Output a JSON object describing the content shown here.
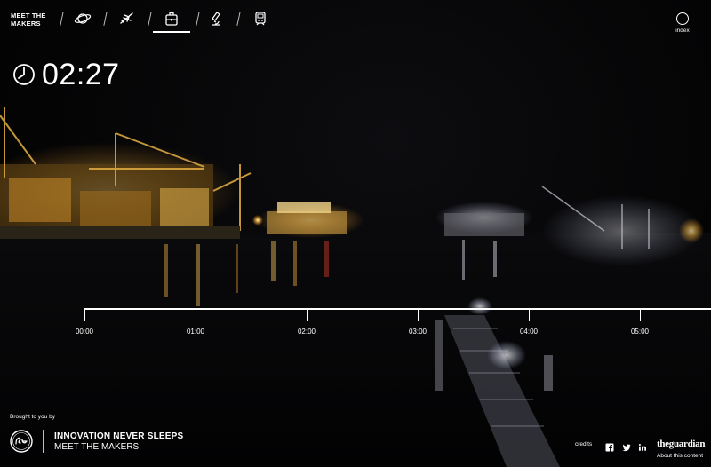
{
  "brand": {
    "line1": "MEET THE",
    "line2": "MAKERS"
  },
  "nav": {
    "items": [
      {
        "name": "planet",
        "icon": "planet-icon"
      },
      {
        "name": "aviation",
        "icon": "airplane-icon"
      },
      {
        "name": "shipping",
        "icon": "luggage-icon",
        "active": true
      },
      {
        "name": "science",
        "icon": "microscope-icon"
      },
      {
        "name": "rail",
        "icon": "train-icon"
      }
    ]
  },
  "index": {
    "label": "index"
  },
  "clock": {
    "icon": "clock-icon",
    "time": "02:27"
  },
  "timeline": {
    "labels": [
      "00:00",
      "01:00",
      "02:00",
      "03:00",
      "04:00",
      "05:00"
    ]
  },
  "footer": {
    "brought_by": "Brought to you by",
    "sponsor_logo": "ge-logo",
    "campaign_title": "INNOVATION NEVER SLEEPS",
    "campaign_subtitle": "MEET THE MAKERS",
    "credits": "credits",
    "social": [
      "facebook-icon",
      "twitter-icon",
      "linkedin-icon"
    ],
    "publisher": "theguardian",
    "about": "About this content"
  },
  "colors": {
    "accent": "#ffffff",
    "light_glow": "#ffc24a",
    "background": "#000000"
  }
}
